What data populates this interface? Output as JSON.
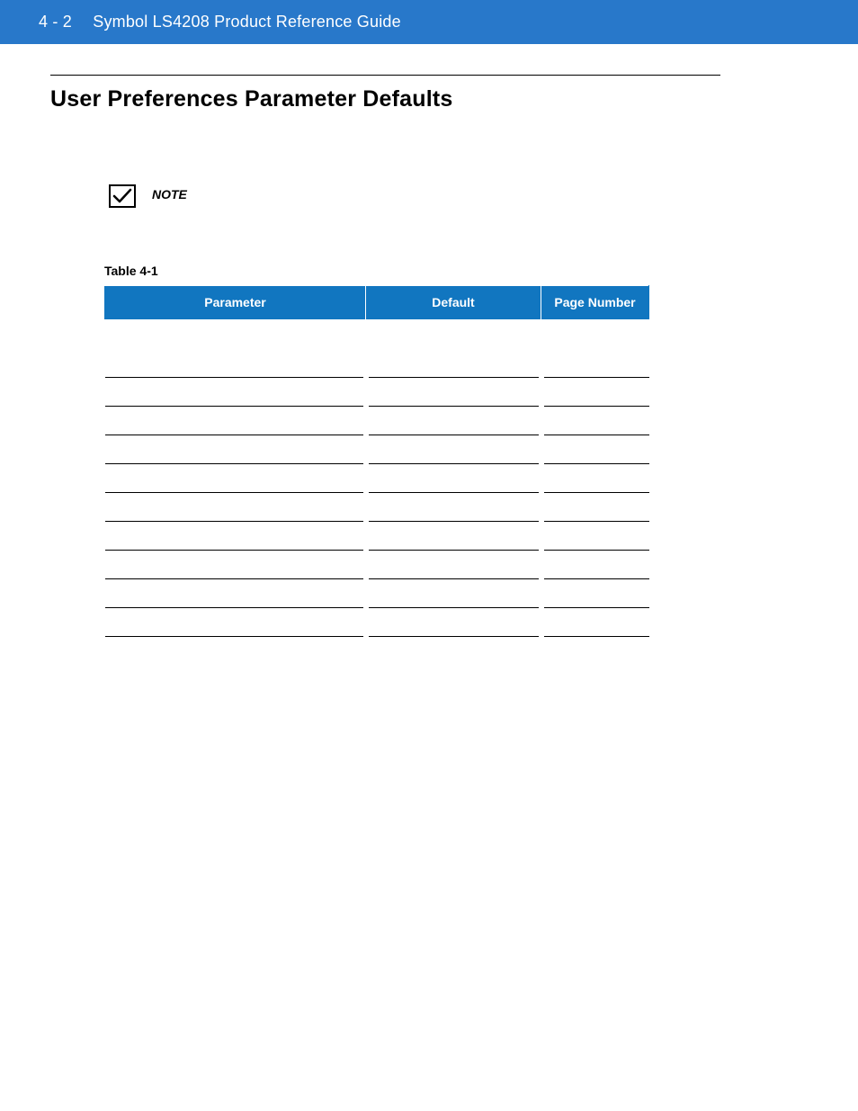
{
  "header": {
    "page_num": "4 - 2",
    "doc_title": "Symbol LS4208 Product Reference Guide"
  },
  "section": {
    "title": "User Preferences Parameter Defaults"
  },
  "note": {
    "label": "NOTE"
  },
  "table": {
    "caption": "Table 4-1",
    "headers": {
      "parameter": "Parameter",
      "default": "Default",
      "page_number": "Page Number"
    },
    "rows": [
      {
        "parameter": "",
        "default": "",
        "page_number": ""
      },
      {
        "parameter": "",
        "default": "",
        "page_number": ""
      },
      {
        "parameter": "",
        "default": "",
        "page_number": ""
      },
      {
        "parameter": "",
        "default": "",
        "page_number": ""
      },
      {
        "parameter": "",
        "default": "",
        "page_number": ""
      },
      {
        "parameter": "",
        "default": "",
        "page_number": ""
      },
      {
        "parameter": "",
        "default": "",
        "page_number": ""
      },
      {
        "parameter": "",
        "default": "",
        "page_number": ""
      },
      {
        "parameter": "",
        "default": "",
        "page_number": ""
      },
      {
        "parameter": "",
        "default": "",
        "page_number": ""
      }
    ]
  }
}
